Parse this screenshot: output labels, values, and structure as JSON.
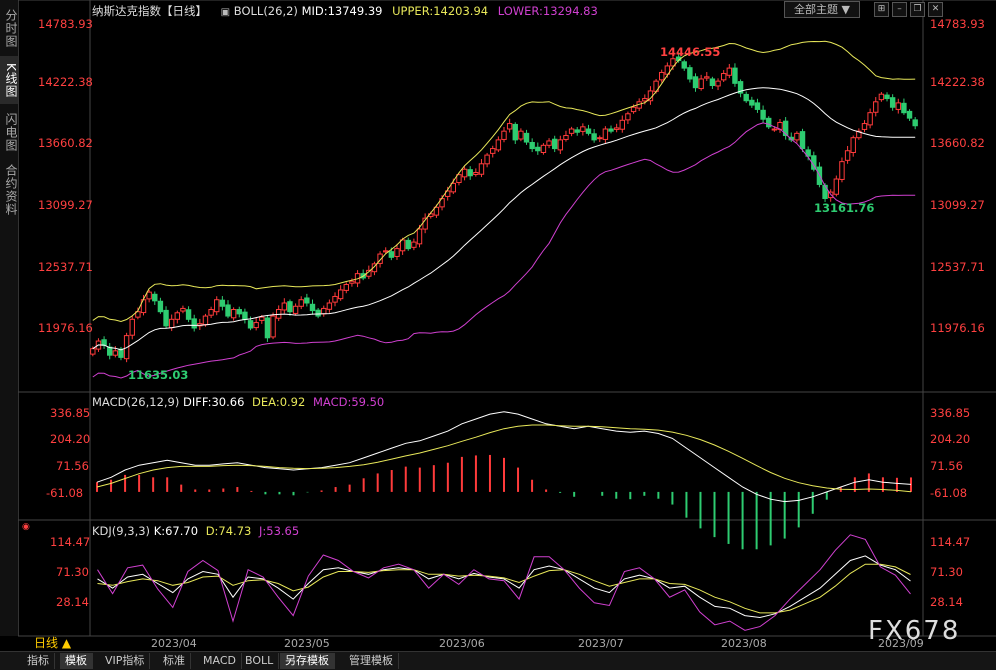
{
  "left_tabs": [
    "分时图",
    "K线图",
    "闪电图",
    "合约资料"
  ],
  "main": {
    "header": {
      "title": "纳斯达克指数【日线】",
      "indicator": "BOLL(26,2)",
      "mid": "MID:13749.39",
      "upper": "UPPER:14203.94",
      "lower": "LOWER:13294.83"
    },
    "theme_button": "全部主题",
    "tool_icons": [
      "grid-icon",
      "minus-icon",
      "restore-icon",
      "close-icon"
    ],
    "y_labels": [
      "14783.93",
      "14222.38",
      "13660.82",
      "13099.27",
      "12537.71",
      "11976.16"
    ],
    "annotations": {
      "high": "14446.55",
      "low_recent": "13161.76",
      "low_start": "11635.03"
    }
  },
  "macd": {
    "header": {
      "name": "MACD(26,12,9)",
      "diff": "DIFF:30.66",
      "dea": "DEA:0.92",
      "macd": "MACD:59.50"
    },
    "y_labels": [
      "336.85",
      "204.20",
      "71.56",
      "-61.08"
    ]
  },
  "kdj": {
    "header": {
      "name": "KDJ(9,3,3)",
      "k": "K:67.70",
      "d": "D:74.73",
      "j": "J:53.65"
    },
    "y_labels": [
      "114.47",
      "71.30",
      "28.14"
    ]
  },
  "time_axis": {
    "period": "日线 ▲",
    "labels": [
      "2023/04",
      "2023/05",
      "2023/06",
      "2023/07",
      "2023/08",
      "2023/09"
    ]
  },
  "bottom_tabs": [
    "指标",
    "模板",
    "VIP指标",
    "标准",
    "MACD",
    "BOLL",
    "另存模板",
    "管理模板"
  ],
  "watermark": "FX678",
  "colors": {
    "up": "#ff3b3b",
    "down": "#2ecc71",
    "upper": "#e8e85a",
    "mid": "#ffffff",
    "lower": "#d040d0",
    "text_red": "#ff4040"
  },
  "chart_data": [
    {
      "type": "candlestick",
      "title": "纳斯达克指数【日线】",
      "x": [
        "2023/04",
        "2023/05",
        "2023/06",
        "2023/07",
        "2023/08",
        "2023/09"
      ],
      "ylim": [
        11700,
        14783.93
      ],
      "closes": [
        11780,
        11850,
        11810,
        11720,
        11760,
        11700,
        11900,
        12050,
        12120,
        12230,
        12300,
        12220,
        12120,
        11990,
        12050,
        12110,
        12150,
        12050,
        11970,
        12010,
        12080,
        12140,
        12230,
        12170,
        12080,
        12140,
        12100,
        12050,
        11970,
        12020,
        12070,
        11880,
        12080,
        12140,
        12200,
        12120,
        12170,
        12230,
        12200,
        12130,
        12080,
        12150,
        12200,
        12260,
        12320,
        12370,
        12400,
        12470,
        12430,
        12500,
        12560,
        12650,
        12680,
        12620,
        12700,
        12780,
        12700,
        12760,
        12880,
        12980,
        13020,
        13080,
        13160,
        13230,
        13300,
        13380,
        13430,
        13370,
        13400,
        13480,
        13560,
        13620,
        13700,
        13780,
        13850,
        13700,
        13780,
        13680,
        13620,
        13600,
        13650,
        13690,
        13620,
        13700,
        13740,
        13800,
        13770,
        13820,
        13760,
        13700,
        13720,
        13800,
        13780,
        13810,
        13880,
        13940,
        14000,
        14050,
        14080,
        14150,
        14240,
        14320,
        14380,
        14446,
        14430,
        14360,
        14260,
        14180,
        14260,
        14280,
        14200,
        14240,
        14310,
        14360,
        14220,
        14130,
        14060,
        14020,
        13980,
        13890,
        13820,
        13800,
        13860,
        13740,
        13700,
        13760,
        13620,
        13550,
        13430,
        13290,
        13161,
        13220,
        13340,
        13500,
        13600,
        13720,
        13780,
        13850,
        13950,
        14050,
        14120,
        14080,
        14000,
        14040,
        13950,
        13900,
        13830
      ]
    },
    {
      "type": "bar",
      "title": "MACD(26,12,9)",
      "ylim": [
        -95,
        336.85
      ],
      "series": [
        {
          "name": "DIFF",
          "values": [
            40,
            60,
            90,
            110,
            120,
            130,
            120,
            110,
            110,
            115,
            120,
            110,
            100,
            95,
            90,
            95,
            100,
            110,
            120,
            140,
            160,
            180,
            200,
            210,
            230,
            250,
            280,
            300,
            320,
            330,
            320,
            300,
            280,
            270,
            260,
            270,
            260,
            250,
            245,
            250,
            240,
            220,
            180,
            140,
            100,
            60,
            20,
            -10,
            -30,
            -40,
            -35,
            -20,
            0,
            20,
            40,
            50,
            40,
            35,
            30.66
          ]
        },
        {
          "name": "DEA",
          "values": [
            20,
            35,
            55,
            75,
            90,
            100,
            105,
            105,
            105,
            108,
            110,
            108,
            105,
            100,
            97,
            96,
            97,
            100,
            105,
            112,
            122,
            135,
            148,
            160,
            175,
            190,
            208,
            225,
            244,
            260,
            270,
            275,
            275,
            272,
            270,
            270,
            268,
            264,
            260,
            258,
            254,
            246,
            233,
            215,
            193,
            167,
            138,
            108,
            80,
            56,
            38,
            25,
            16,
            11,
            10,
            12,
            10,
            6,
            0.92
          ]
        },
        {
          "name": "MACD",
          "values": [
            40,
            50,
            70,
            70,
            60,
            60,
            30,
            10,
            10,
            14,
            20,
            4,
            -10,
            -10,
            -14,
            -2,
            6,
            20,
            30,
            56,
            76,
            90,
            104,
            100,
            110,
            120,
            144,
            150,
            152,
            140,
            100,
            50,
            10,
            -4,
            -20,
            0,
            -16,
            -28,
            -30,
            -16,
            -28,
            -52,
            -106,
            -150,
            -186,
            -214,
            -236,
            -236,
            -220,
            -192,
            -146,
            -90,
            -32,
            18,
            60,
            76,
            60,
            58,
            59.5
          ]
        }
      ]
    },
    {
      "type": "line",
      "title": "KDJ(9,3,3)",
      "ylim": [
        10,
        114.47
      ],
      "series": [
        {
          "name": "K",
          "values": [
            70,
            60,
            72,
            75,
            65,
            55,
            70,
            78,
            75,
            50,
            72,
            70,
            60,
            48,
            65,
            80,
            82,
            78,
            75,
            80,
            82,
            80,
            70,
            75,
            70,
            76,
            72,
            70,
            60,
            80,
            84,
            80,
            70,
            60,
            55,
            70,
            74,
            70,
            60,
            62,
            50,
            40,
            38,
            30,
            28,
            32,
            40,
            50,
            60,
            75,
            90,
            95,
            85,
            80,
            67.7
          ]
        },
        {
          "name": "D",
          "values": [
            65,
            63,
            67,
            70,
            68,
            63,
            66,
            72,
            73,
            63,
            68,
            69,
            65,
            57,
            61,
            72,
            78,
            78,
            77,
            79,
            80,
            80,
            75,
            75,
            73,
            74,
            73,
            71,
            66,
            73,
            79,
            80,
            75,
            68,
            62,
            66,
            70,
            70,
            65,
            64,
            58,
            50,
            45,
            38,
            33,
            33,
            36,
            43,
            50,
            62,
            76,
            86,
            86,
            83,
            74.73
          ]
        },
        {
          "name": "J",
          "values": [
            80,
            54,
            82,
            85,
            59,
            39,
            78,
            90,
            79,
            24,
            80,
            72,
            50,
            30,
            73,
            96,
            90,
            78,
            71,
            82,
            86,
            80,
            60,
            75,
            64,
            80,
            70,
            68,
            48,
            94,
            94,
            80,
            60,
            44,
            41,
            78,
            82,
            70,
            50,
            58,
            34,
            20,
            24,
            14,
            18,
            30,
            48,
            64,
            80,
            101,
            118,
            113,
            83,
            74,
            53.65
          ]
        }
      ]
    }
  ]
}
